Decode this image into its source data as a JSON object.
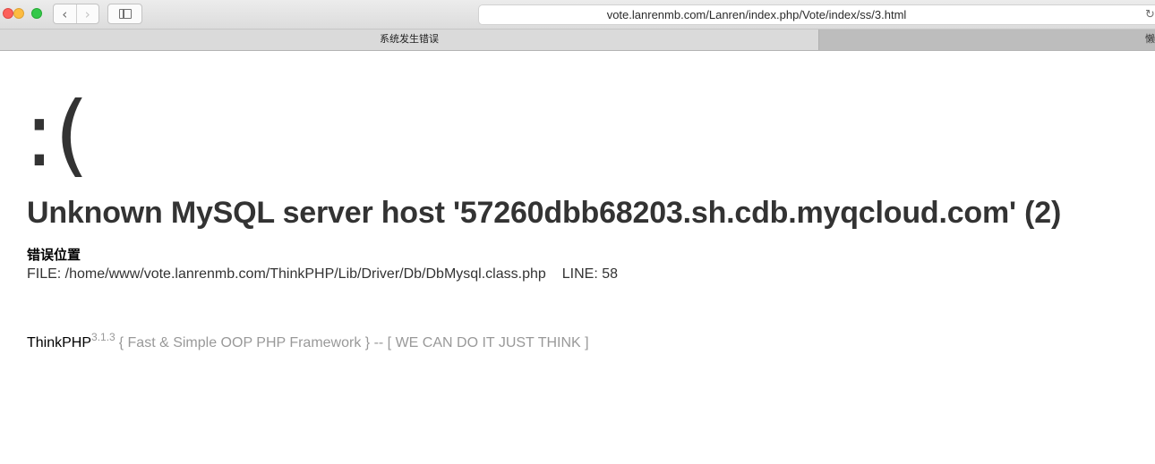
{
  "browser": {
    "url": "vote.lanrenmb.com/Lanren/index.php/Vote/index/ss/3.html",
    "back_icon": "chevron-left-icon",
    "forward_icon": "chevron-right-icon",
    "sidebar_icon": "sidebar-icon",
    "reload_icon": "reload-icon",
    "tabs": [
      {
        "label": "系统发生错误",
        "active": true
      },
      {
        "label": "懒",
        "active": false
      }
    ]
  },
  "page": {
    "face": ":(",
    "error_message": "Unknown MySQL server host '57260dbb68203.sh.cdb.myqcloud.com' (2)",
    "location_title": "错误位置",
    "file": "FILE: /home/www/vote.lanrenmb.com/ThinkPHP/Lib/Driver/Db/DbMysql.class.php",
    "line": "LINE: 58",
    "footer": {
      "brand": "ThinkPHP",
      "version": "3.1.3",
      "tagline": "{ Fast & Simple OOP PHP Framework } -- [ WE CAN DO IT JUST THINK ]"
    }
  },
  "colors": {
    "text": "#333333",
    "muted": "#999999",
    "close": "#fc605b",
    "minimize": "#fdbc40",
    "maximize": "#34c84a"
  }
}
